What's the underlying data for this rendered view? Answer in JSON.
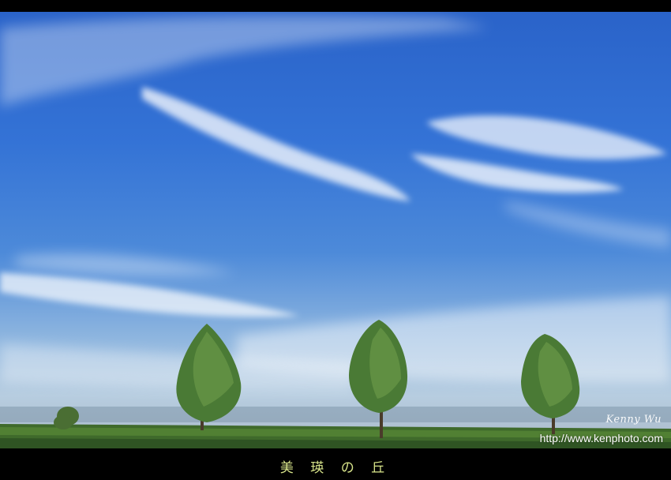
{
  "photo": {
    "subject": "Blue sky with wispy clouds over a green field with three poplar trees",
    "colors": {
      "sky_top": "#2a63c9",
      "sky_horizon": "#b7cde0",
      "field": "#3d6b2a",
      "tree": "#4e7a36"
    }
  },
  "watermark": {
    "signature": "Kenny Wu",
    "url": "http://www.kenphoto.com"
  },
  "caption": "美 瑛 の 丘"
}
